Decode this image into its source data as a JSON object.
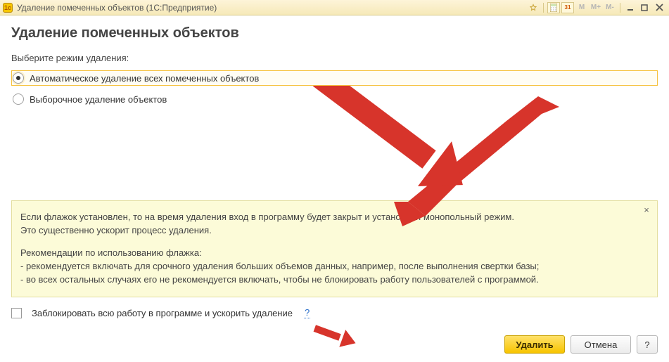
{
  "window": {
    "title": "Удаление помеченных объектов  (1С:Предприятие)",
    "toolbar_mem_m": "M",
    "toolbar_mem_mplus": "M+",
    "toolbar_mem_mminus": "M-",
    "toolbar_calendar_day": "31"
  },
  "header": {
    "title": "Удаление помеченных объектов"
  },
  "mode": {
    "prompt": "Выберите режим удаления:",
    "options": [
      {
        "label": "Автоматическое удаление всех помеченных объектов",
        "selected": true
      },
      {
        "label": "Выборочное удаление объектов",
        "selected": false
      }
    ]
  },
  "hint": {
    "line1": "Если флажок установлен, то на время удаления вход в программу будет закрыт и установлен монопольный режим.",
    "line2": "Это существенно ускорит процесс удаления.",
    "rec_title": "Рекомендации по использованию флажка:",
    "rec1": "- рекомендуется включать для срочного удаления больших объемов данных, например, после выполнения свертки базы;",
    "rec2": "- во всех остальных случаях его не рекомендуется включать, чтобы не блокировать работу пользователей с программой.",
    "close_glyph": "×"
  },
  "checkbox": {
    "label": "Заблокировать всю работу в программе и ускорить удаление",
    "help_glyph": "?"
  },
  "footer": {
    "delete": "Удалить",
    "cancel": "Отмена",
    "help": "?"
  }
}
